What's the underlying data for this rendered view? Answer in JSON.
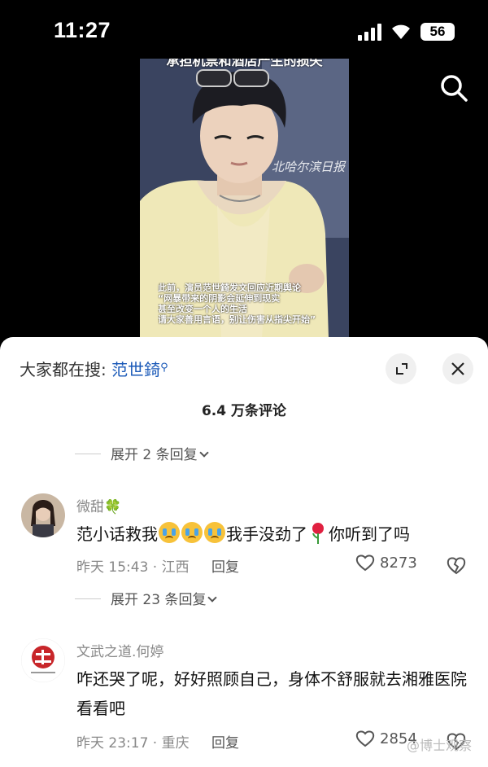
{
  "status_bar": {
    "time": "11:27",
    "battery": "56"
  },
  "video": {
    "caption_top": "承担机票和酒店产生的损失",
    "watermark": "北哈尔滨日报",
    "caption_lines": [
      "此前，演员范世錡发文回应近期舆论",
      "“网暴带来的阴影会延伸到现实",
      "甚至改变一个人的生活",
      "请大家善用言语，别让伤害从指尖开始”"
    ]
  },
  "sheet": {
    "search_prefix": "大家都在搜:",
    "search_keyword": "范世錡",
    "comment_count": "6.4 万条评论",
    "expand_top": "展开 2 条回复"
  },
  "comments": [
    {
      "username": "微甜🍀",
      "text_a": "范小话救我",
      "text_b": "我手没劲了",
      "text_c": "你听到了吗",
      "time": "昨天 15:43 · 江西",
      "reply": "回复",
      "likes": "8273",
      "expand": "展开 23 条回复"
    },
    {
      "username": "文武之道.何婷",
      "text": "咋还哭了呢，好好照顾自己，身体不舒服就去湘雅医院看看吧",
      "time": "昨天 23:17 · 重庆",
      "reply": "回复",
      "likes": "2854"
    }
  ],
  "corner_watermark": "@博士观察",
  "colors": {
    "link": "#1a59b8",
    "sheet_bg": "#ffffff",
    "background": "#000000"
  }
}
